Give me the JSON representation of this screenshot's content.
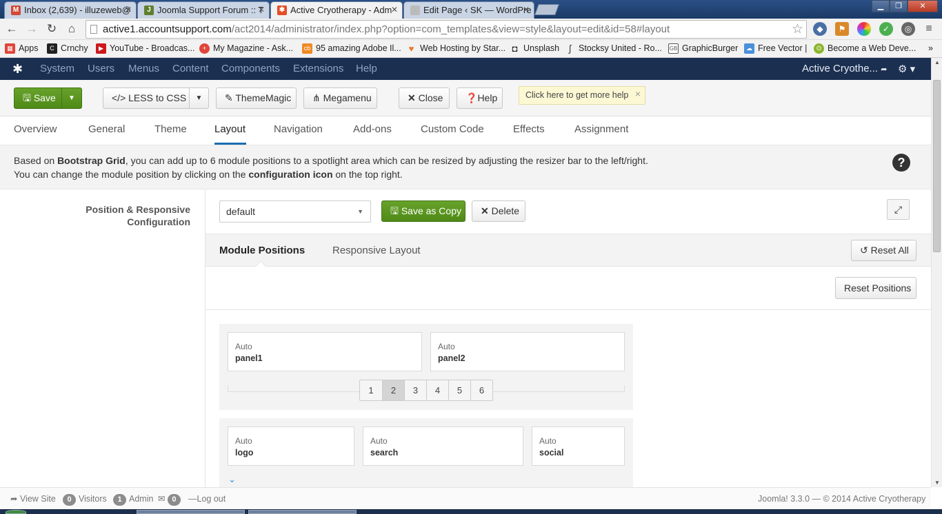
{
  "browser": {
    "tabs": [
      {
        "label": "Inbox (2,639) - illuzeweb@",
        "icon": "gmail-icon",
        "color": "#d14836"
      },
      {
        "label": "Joomla Support Forum :: T",
        "icon": "forum-icon",
        "color": "#5f7f2e"
      },
      {
        "label": "Active Cryotherapy - Adm",
        "icon": "joomla-icon",
        "color": "#e44d26"
      },
      {
        "label": "Edit Page ‹ SK — WordPre",
        "icon": "page-icon",
        "color": "#999999"
      }
    ],
    "window_buttons": {
      "minimize": "▁",
      "maximize": "❐",
      "close": "✕"
    },
    "url_host": "active1.accountsupport.com",
    "url_path": "/act2014/administrator/index.php?option=com_templates&view=style&layout=edit&id=58#layout",
    "bookmarks": [
      {
        "label": "Apps",
        "color": "#e0453a"
      },
      {
        "label": "Crnchy",
        "color": "#222222"
      },
      {
        "label": "YouTube - Broadcas...",
        "color": "#cc181e"
      },
      {
        "label": "My Magazine - Ask...",
        "color": "#e0453a"
      },
      {
        "label": "95 amazing Adobe Il...",
        "color": "#f08a24"
      },
      {
        "label": "Web Hosting by Star...",
        "color": "#e87a2a"
      },
      {
        "label": "Unsplash",
        "color": "#222222"
      },
      {
        "label": "Stocksy United - Ro...",
        "color": "#444444"
      },
      {
        "label": "GraphicBurger",
        "color": "#555555"
      },
      {
        "label": "Free Vector |",
        "color": "#4a90d9"
      },
      {
        "label": "Become a Web Deve...",
        "color": "#8bb52a"
      }
    ],
    "bookmarks_more": "»"
  },
  "admin_nav": {
    "menu": [
      "System",
      "Users",
      "Menus",
      "Content",
      "Components",
      "Extensions",
      "Help"
    ],
    "site_name": "Active Cryothe...",
    "site_icon": "external-link-icon",
    "gear": "⚙ ▾"
  },
  "toolbar": {
    "save": "Save",
    "less_to_css": "LESS to CSS",
    "thememagic": "ThemeMagic",
    "megamenu": "Megamenu",
    "close": "Close",
    "help": "Help",
    "tip": "Click here to get more help"
  },
  "tabs": {
    "items": [
      "Overview",
      "General",
      "Theme",
      "Layout",
      "Navigation",
      "Add-ons",
      "Custom Code",
      "Effects",
      "Assignment"
    ],
    "active": "Layout"
  },
  "info": {
    "l1_pre": "Based on ",
    "l1_bold": "Bootstrap Grid",
    "l1_post": ", you can add up to 6 module positions to a spotlight area which can be resized by adjusting the resizer bar to the left/right.",
    "l2_pre": "You can change the module position by clicking on the ",
    "l2_bold": "configuration icon",
    "l2_post": " on the top right."
  },
  "layout": {
    "label_line1": "Position & Responsive",
    "label_line2": "Configuration",
    "select_value": "default",
    "save_as_copy": "Save as Copy",
    "delete": "Delete",
    "tab_module_positions": "Module Positions",
    "tab_responsive_layout": "Responsive Layout",
    "reset_all": "Reset All",
    "reset_positions": "Reset Positions",
    "row1": [
      {
        "width": "Auto",
        "name": "panel1"
      },
      {
        "width": "Auto",
        "name": "panel2"
      }
    ],
    "pager": [
      "1",
      "2",
      "3",
      "4",
      "5",
      "6"
    ],
    "pager_selected": "2",
    "row2": [
      {
        "width": "Auto",
        "name": "logo"
      },
      {
        "width": "Auto",
        "name": "search"
      },
      {
        "width": "Auto",
        "name": "social"
      }
    ]
  },
  "footer": {
    "view_site": "View Site",
    "visitors_count": "0",
    "visitors": "Visitors",
    "admin_count": "1",
    "admin": "Admin",
    "messages_count": "0",
    "logout": "Log out",
    "copyright": "Joomla! 3.3.0 — © 2014 Active Cryotherapy"
  }
}
